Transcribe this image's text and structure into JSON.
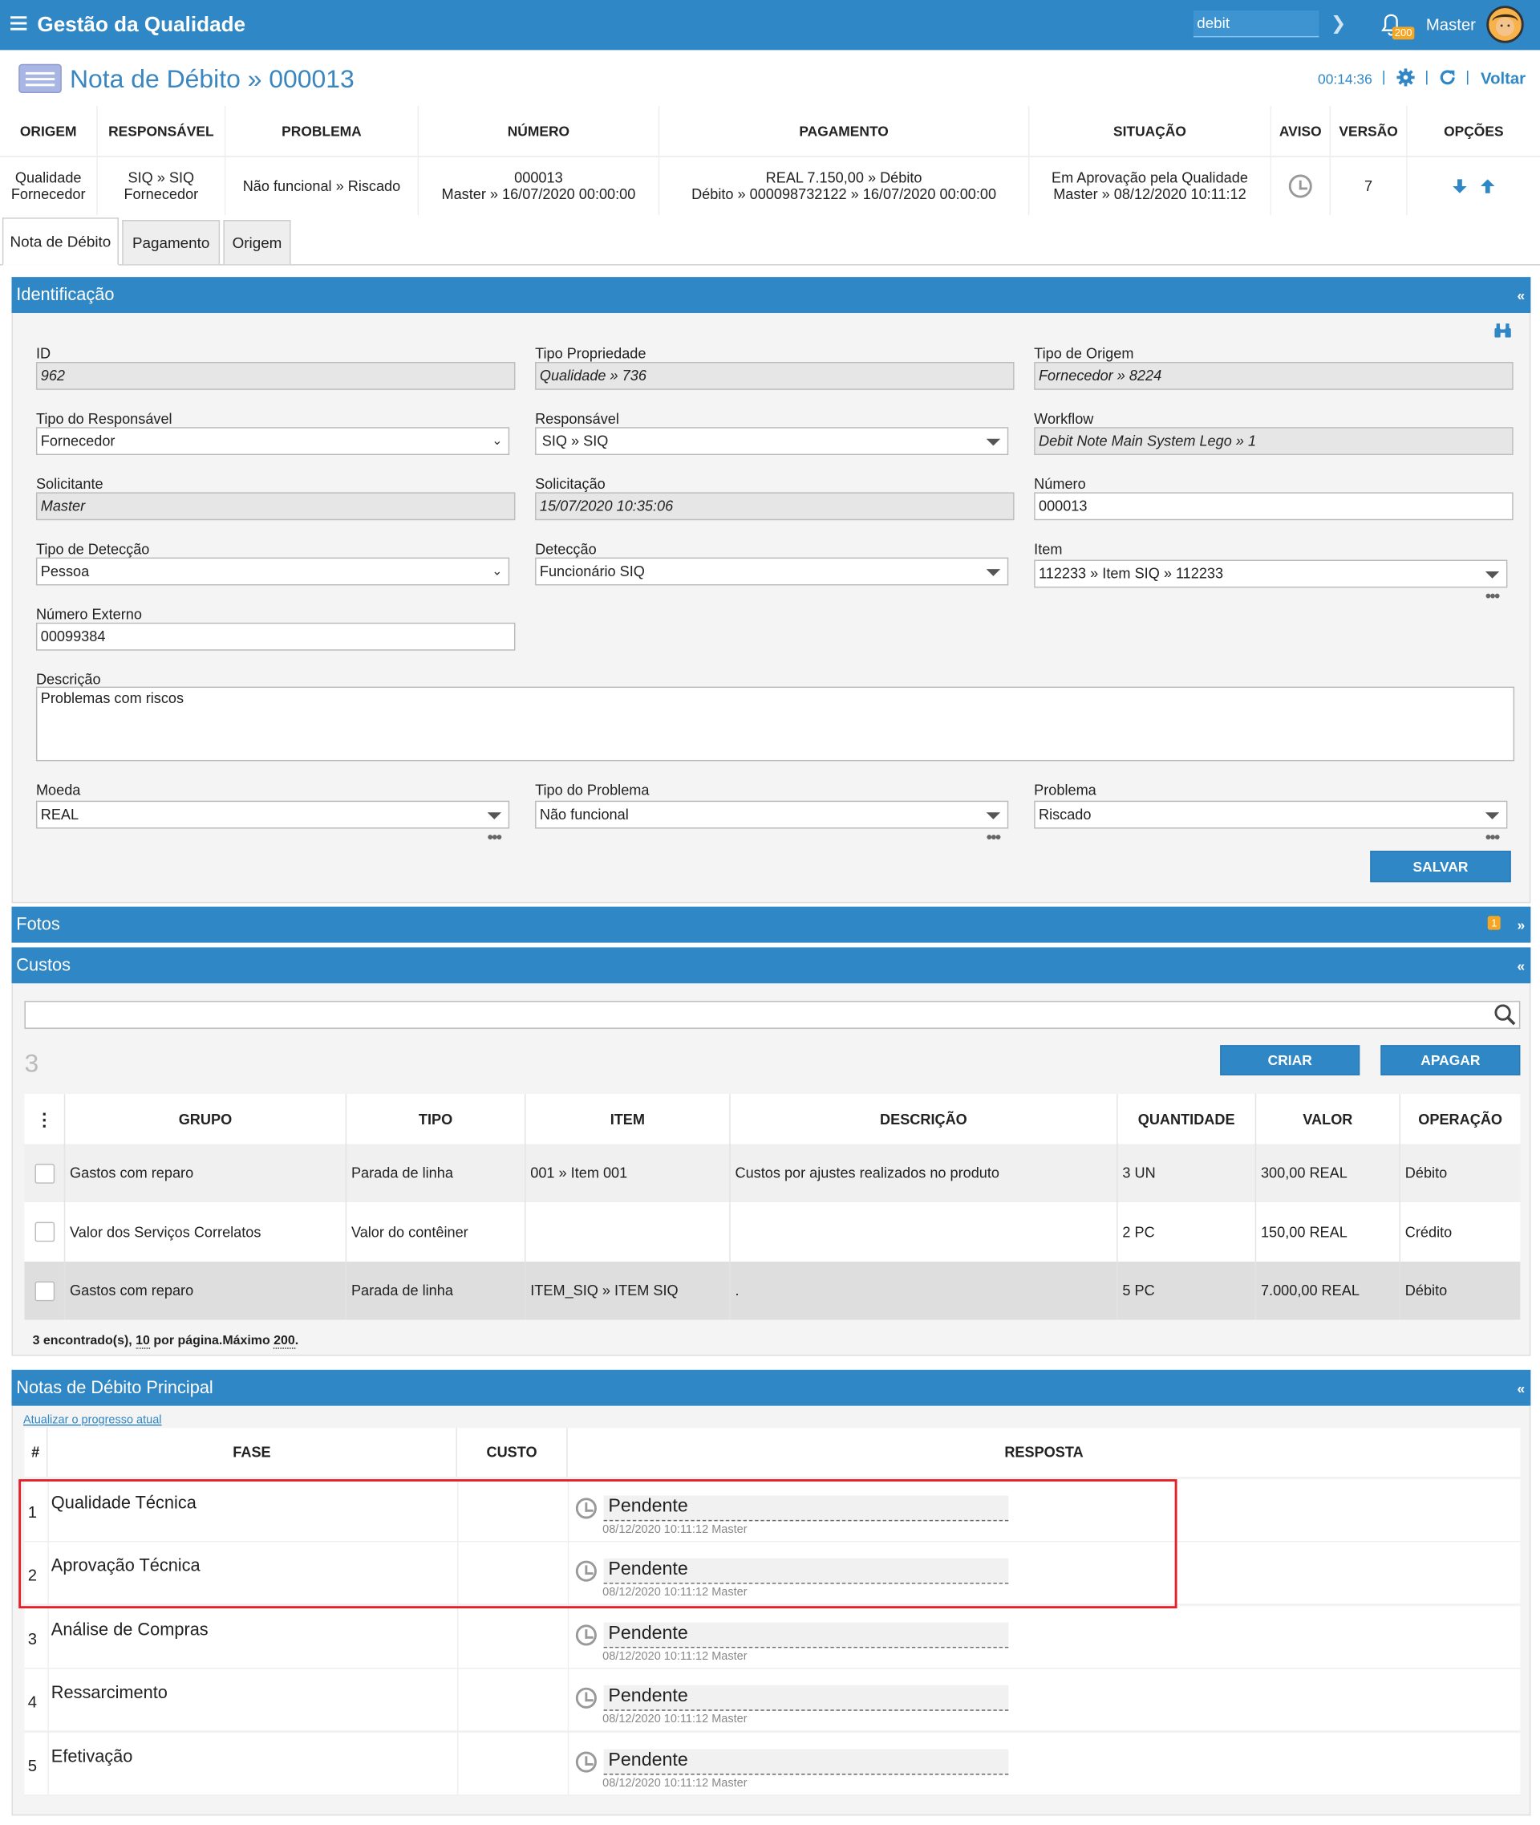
{
  "topbar": {
    "title": "Gestão da Qualidade",
    "search_value": "debit",
    "user": "Master",
    "badge": "200"
  },
  "header": {
    "title": "Nota de Débito » 000013",
    "time": "00:14:36",
    "back": "Voltar"
  },
  "summary": {
    "columns": [
      "ORIGEM",
      "RESPONSÁVEL",
      "PROBLEMA",
      "NÚMERO",
      "PAGAMENTO",
      "SITUAÇÃO",
      "AVISO",
      "VERSÃO",
      "OPÇÕES"
    ],
    "origem": [
      "Qualidade",
      "Fornecedor"
    ],
    "responsavel": [
      "SIQ » SIQ",
      "Fornecedor"
    ],
    "problema": "Não funcional » Riscado",
    "numero": [
      "000013",
      "Master » 16/07/2020 00:00:00"
    ],
    "pagamento": [
      "REAL 7.150,00 » Débito",
      "Débito » 000098732122 » 16/07/2020 00:00:00"
    ],
    "situacao": [
      "Em Aprovação pela Qualidade",
      "Master » 08/12/2020 10:11:12"
    ],
    "versao": "7"
  },
  "tabs": [
    "Nota de Débito",
    "Pagamento",
    "Origem"
  ],
  "identificacao": {
    "title": "Identificação",
    "fields": {
      "id": {
        "label": "ID",
        "value": "962"
      },
      "tipo_propriedade": {
        "label": "Tipo Propriedade",
        "value": "Qualidade » 736"
      },
      "tipo_origem": {
        "label": "Tipo de Origem",
        "value": "Fornecedor » 8224"
      },
      "tipo_responsavel": {
        "label": "Tipo do Responsável",
        "value": "Fornecedor"
      },
      "responsavel": {
        "label": "Responsável",
        "value": "SIQ » SIQ"
      },
      "workflow": {
        "label": "Workflow",
        "value": "Debit Note Main System Lego » 1"
      },
      "solicitante": {
        "label": "Solicitante",
        "value": "Master"
      },
      "solicitacao": {
        "label": "Solicitação",
        "value": "15/07/2020 10:35:06"
      },
      "numero": {
        "label": "Número",
        "value": "000013"
      },
      "tipo_deteccao": {
        "label": "Tipo de Detecção",
        "value": "Pessoa"
      },
      "deteccao": {
        "label": "Detecção",
        "value": "Funcionário SIQ"
      },
      "item": {
        "label": "Item",
        "value": "112233 » Item SIQ » 112233"
      },
      "numero_externo": {
        "label": "Número Externo",
        "value": "00099384"
      },
      "descricao": {
        "label": "Descrição",
        "value": "Problemas com riscos"
      },
      "moeda": {
        "label": "Moeda",
        "value": "REAL"
      },
      "tipo_problema": {
        "label": "Tipo do Problema",
        "value": "Não funcional"
      },
      "problema": {
        "label": "Problema",
        "value": "Riscado"
      }
    },
    "save": "SALVAR"
  },
  "fotos": {
    "title": "Fotos",
    "badge": "1"
  },
  "custos": {
    "title": "Custos",
    "count": "3",
    "create": "CRIAR",
    "delete": "APAGAR",
    "columns": [
      "GRUPO",
      "TIPO",
      "ITEM",
      "DESCRIÇÃO",
      "QUANTIDADE",
      "VALOR",
      "OPERAÇÃO"
    ],
    "rows": [
      {
        "grupo": "Gastos com reparo",
        "tipo": "Parada de linha",
        "item": "001 » Item 001",
        "descricao": "Custos por ajustes realizados no produto",
        "quantidade": "3 UN",
        "valor": "300,00 REAL",
        "operacao": "Débito"
      },
      {
        "grupo": "Valor dos Serviços Correlatos",
        "tipo": "Valor do contêiner",
        "item": "",
        "descricao": "",
        "quantidade": "2 PC",
        "valor": "150,00 REAL",
        "operacao": "Crédito"
      },
      {
        "grupo": "Gastos com reparo",
        "tipo": "Parada de linha",
        "item": "ITEM_SIQ » ITEM SIQ",
        "descricao": ".",
        "quantidade": "5 PC",
        "valor": "7.000,00 REAL",
        "operacao": "Débito"
      }
    ],
    "footer": {
      "found": "3 encontrado(s),",
      "per_page": "10",
      "per_page_label": "por página.Máximo",
      "max": "200",
      "end": "."
    }
  },
  "notas": {
    "title": "Notas de Débito Principal",
    "refresh": "Atualizar o progresso atual",
    "columns": [
      "#",
      "FASE",
      "CUSTO",
      "RESPOSTA"
    ],
    "rows": [
      {
        "n": "1",
        "fase": "Qualidade Técnica",
        "status": "Pendente",
        "meta": "08/12/2020 10:11:12",
        "user": "Master"
      },
      {
        "n": "2",
        "fase": "Aprovação Técnica",
        "status": "Pendente",
        "meta": "08/12/2020 10:11:12",
        "user": "Master"
      },
      {
        "n": "3",
        "fase": "Análise de Compras",
        "status": "Pendente",
        "meta": "08/12/2020 10:11:12",
        "user": "Master"
      },
      {
        "n": "4",
        "fase": "Ressarcimento",
        "status": "Pendente",
        "meta": "08/12/2020 10:11:12",
        "user": "Master"
      },
      {
        "n": "5",
        "fase": "Efetivação",
        "status": "Pendente",
        "meta": "08/12/2020 10:11:12",
        "user": "Master"
      }
    ]
  },
  "colors": {
    "primary": "#2f87c6",
    "highlight": "#e3202a",
    "badge": "#f5a623"
  }
}
